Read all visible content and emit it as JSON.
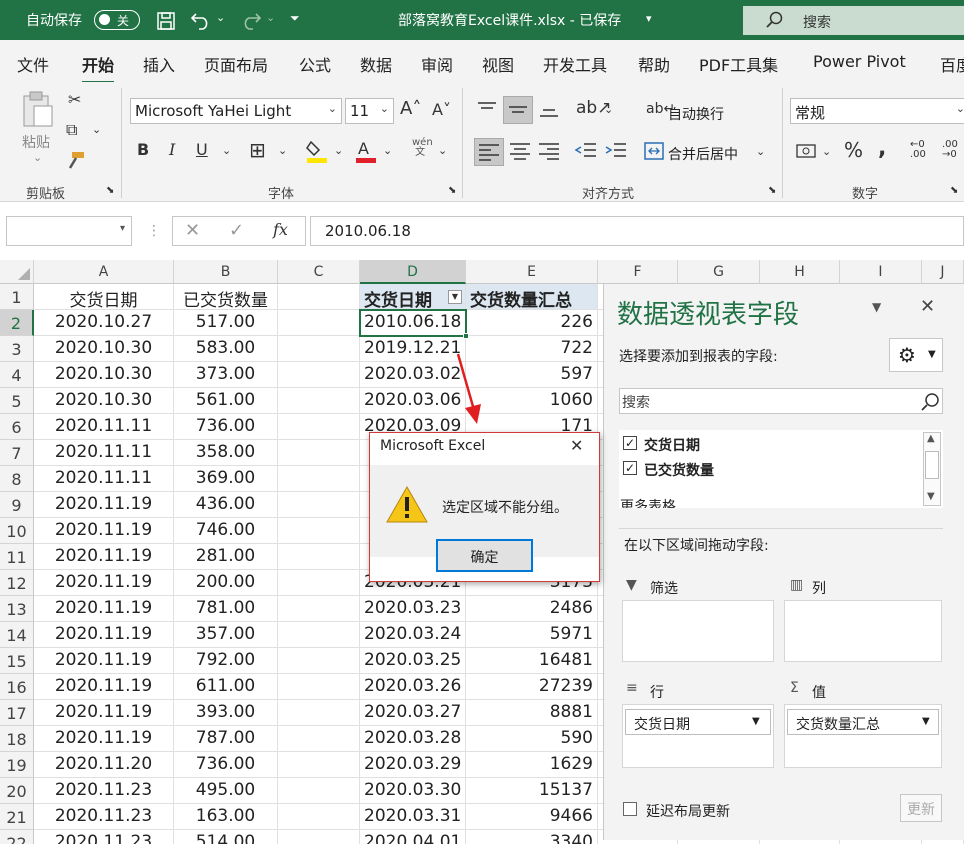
{
  "titlebar": {
    "autosave_label": "自动保存",
    "autosave_state": "关",
    "filename": "部落窝教育Excel课件.xlsx - 已保存",
    "search_placeholder": "搜索"
  },
  "tabs": [
    "文件",
    "开始",
    "插入",
    "页面布局",
    "公式",
    "数据",
    "审阅",
    "视图",
    "开发工具",
    "帮助",
    "PDF工具集",
    "Power Pivot",
    "百度"
  ],
  "ribbon": {
    "clipboard_label": "剪贴板",
    "paste_label": "粘贴",
    "font_label": "字体",
    "font_name": "Microsoft YaHei Light",
    "font_size": "11",
    "align_label": "对齐方式",
    "wrap_label": "自动换行",
    "merge_label": "合并后居中",
    "number_label": "数字",
    "number_format": "常规"
  },
  "formula_bar": {
    "fx": "fx",
    "value": "2010.06.18"
  },
  "columns": [
    "A",
    "B",
    "C",
    "D",
    "E",
    "F",
    "G",
    "H",
    "I",
    "J"
  ],
  "rows": [
    "1",
    "2",
    "3",
    "4",
    "5",
    "6",
    "7",
    "8",
    "9",
    "10",
    "11",
    "12",
    "13",
    "14",
    "15",
    "16",
    "17",
    "18",
    "19",
    "20",
    "21",
    "22"
  ],
  "headers": {
    "a": "交货日期",
    "b": "已交货数量",
    "d": "交货日期",
    "e": "交货数量汇总"
  },
  "colA": [
    "2020.10.27",
    "2020.10.30",
    "2020.10.30",
    "2020.10.30",
    "2020.11.11",
    "2020.11.11",
    "2020.11.11",
    "2020.11.19",
    "2020.11.19",
    "2020.11.19",
    "2020.11.19",
    "2020.11.19",
    "2020.11.19",
    "2020.11.19",
    "2020.11.19",
    "2020.11.19",
    "2020.11.19",
    "2020.11.20",
    "2020.11.23",
    "2020.11.23",
    "2020.11.23"
  ],
  "colB": [
    "517.00",
    "583.00",
    "373.00",
    "561.00",
    "736.00",
    "358.00",
    "369.00",
    "436.00",
    "746.00",
    "281.00",
    "200.00",
    "781.00",
    "357.00",
    "792.00",
    "611.00",
    "393.00",
    "787.00",
    "736.00",
    "495.00",
    "163.00",
    "514.00"
  ],
  "colD": [
    "2010.06.18",
    "2019.12.21",
    "2020.03.02",
    "2020.03.06",
    "2020.03.09",
    "",
    "",
    "",
    "",
    "",
    "2020.03.21",
    "2020.03.23",
    "2020.03.24",
    "2020.03.25",
    "2020.03.26",
    "2020.03.27",
    "2020.03.28",
    "2020.03.29",
    "2020.03.30",
    "2020.03.31",
    "2020.04.01"
  ],
  "colE": [
    "226",
    "722",
    "597",
    "1060",
    "171",
    "",
    "",
    "",
    "",
    "",
    "3173",
    "2486",
    "5971",
    "16481",
    "27239",
    "8881",
    "590",
    "1629",
    "15137",
    "9466",
    "3340"
  ],
  "pivot": {
    "title": "数据透视表字段",
    "choose_label": "选择要添加到报表的字段:",
    "search_placeholder": "搜索",
    "fields": [
      "交货日期",
      "已交货数量"
    ],
    "more_tables": "更多表格",
    "drag_label": "在以下区域间拖动字段:",
    "filter_label": "筛选",
    "columns_label": "列",
    "rows_label": "行",
    "values_label": "值",
    "rows_value": "交货日期",
    "values_value": "交货数量汇总",
    "defer_label": "延迟布局更新",
    "update_label": "更新"
  },
  "dialog": {
    "title": "Microsoft Excel",
    "message": "选定区域不能分组。",
    "ok_label": "确定"
  },
  "colors": {
    "excel_green": "#217346",
    "warning_yellow": "#f5c518",
    "arrow_red": "#e02020"
  }
}
